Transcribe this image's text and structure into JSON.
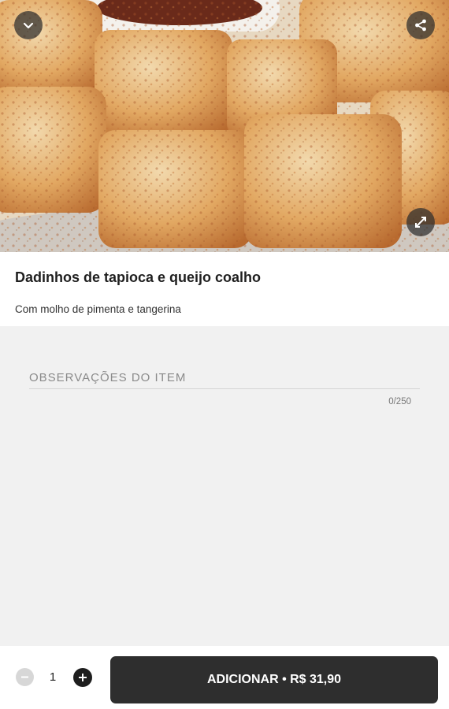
{
  "header": {
    "collapse_icon": "chevron-down-icon",
    "share_icon": "share-icon",
    "expand_icon": "expand-icon"
  },
  "item": {
    "image_alt": "foto do item",
    "title": "Dadinhos de tapioca e queijo coalho",
    "description": "Com molho de pimenta e tangerina"
  },
  "notes": {
    "placeholder": "OBSERVAÇÕES DO ITEM",
    "value": "",
    "counter": "0/250"
  },
  "footer": {
    "quantity": "1",
    "add_label": "ADICIONAR • R$ 31,90"
  },
  "colors": {
    "primary": "#2e2e2e",
    "background": "#f2f2f2",
    "surface": "#ffffff"
  }
}
